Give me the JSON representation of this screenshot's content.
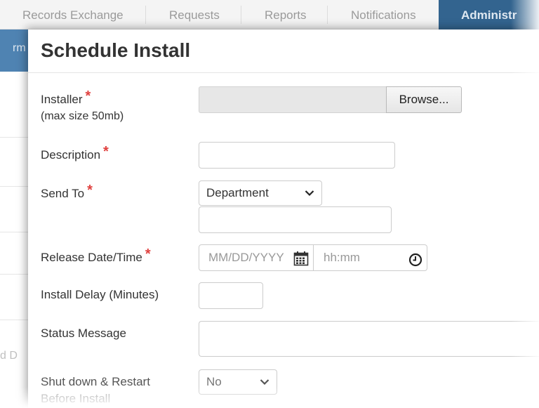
{
  "background_nav": {
    "tabs": [
      "Records Exchange",
      "Requests",
      "Reports",
      "Notifications",
      "Administr"
    ],
    "fragments": [
      "rm",
      "d D"
    ]
  },
  "modal": {
    "title": "Schedule Install",
    "installer": {
      "label": "Installer",
      "sublabel": "(max size 50mb)",
      "required_mark": "*",
      "browse_label": "Browse..."
    },
    "description": {
      "label": "Description",
      "required_mark": "*",
      "value": ""
    },
    "send_to": {
      "label": "Send To",
      "required_mark": "*",
      "selected": "Department",
      "value": ""
    },
    "release": {
      "label": "Release Date/Time",
      "required_mark": "*",
      "date_placeholder": "MM/DD/YYYY",
      "time_placeholder": "hh:mm"
    },
    "install_delay": {
      "label": "Install Delay (Minutes)",
      "value": ""
    },
    "status_message": {
      "label": "Status Message",
      "value": ""
    },
    "shutdown": {
      "label": "Shut down & Restart",
      "label_cont": "Before Install",
      "selected": "No"
    }
  },
  "colors": {
    "required": "#e0413f",
    "nav_active": "#33648f",
    "strip": "#4f83b2"
  }
}
